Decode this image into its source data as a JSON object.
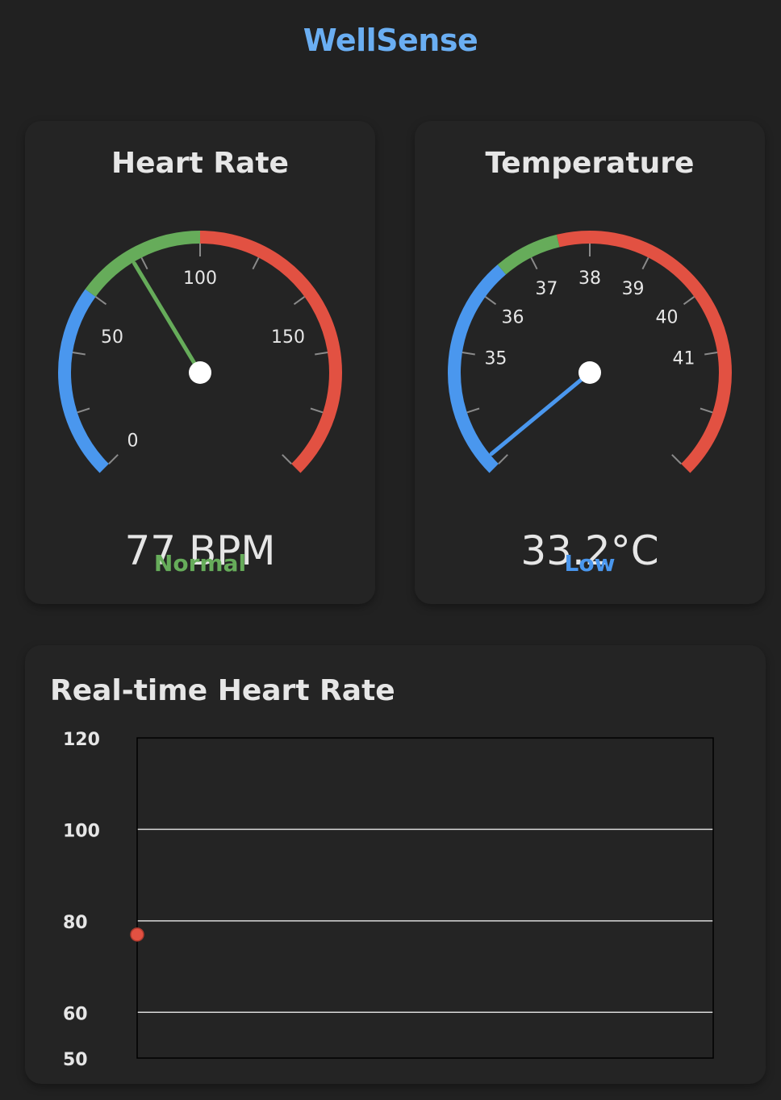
{
  "app": {
    "title": "WellSense"
  },
  "heart_rate": {
    "title": "Heart Rate",
    "reading": "77 BPM",
    "status": "Normal",
    "value": 77,
    "min": 0,
    "max": 200,
    "labels": [
      "0",
      "50",
      "100",
      "150"
    ],
    "label_values": [
      0,
      50,
      100,
      150
    ],
    "zones": [
      {
        "from": 0,
        "to": 60,
        "color": "#4a97ee"
      },
      {
        "from": 60,
        "to": 100,
        "color": "#66ac5a"
      },
      {
        "from": 100,
        "to": 200,
        "color": "#e25142"
      }
    ],
    "needle_color": "#66ac5a",
    "status_color": "#66ac5a"
  },
  "temperature": {
    "title": "Temperature",
    "reading": "33.2°C",
    "status": "Low",
    "value": 33.2,
    "min": 33,
    "max": 43,
    "labels": [
      "35",
      "36",
      "37",
      "38",
      "39",
      "40",
      "41"
    ],
    "label_values": [
      35,
      36,
      37,
      38,
      39,
      40,
      41
    ],
    "zones": [
      {
        "from": 33,
        "to": 36.5,
        "color": "#4a97ee"
      },
      {
        "from": 36.5,
        "to": 37.5,
        "color": "#66ac5a"
      },
      {
        "from": 37.5,
        "to": 43,
        "color": "#e25142"
      }
    ],
    "needle_color": "#4a97ee",
    "status_color": "#4a97ee"
  },
  "chart_data": {
    "type": "line",
    "title": "Real-time Heart Rate",
    "xlabel": "",
    "ylabel": "",
    "ylim": [
      50,
      120
    ],
    "y_ticks": [
      "120",
      "100",
      "80",
      "60",
      "50"
    ],
    "y_tick_values": [
      120,
      100,
      80,
      60,
      50
    ],
    "grid_values": [
      100,
      80,
      60
    ],
    "series": [
      {
        "values": [
          77
        ],
        "color": "#e25142"
      }
    ]
  }
}
